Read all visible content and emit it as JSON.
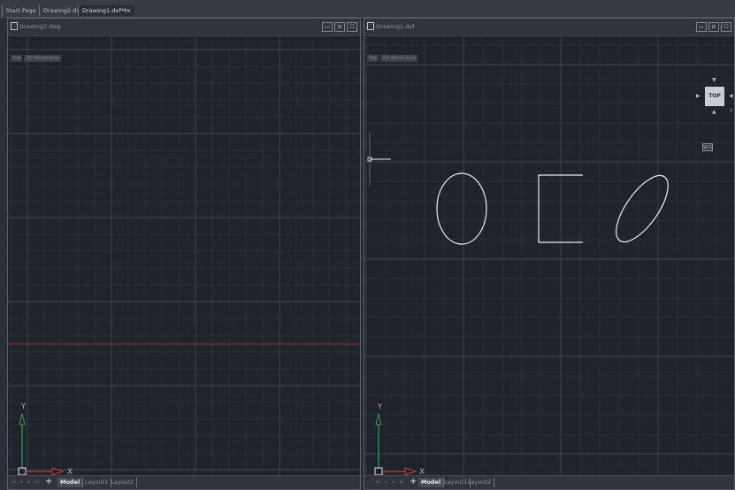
{
  "tabs": [
    {
      "label": "Start Page"
    },
    {
      "label": "Drawing2.dwg"
    },
    {
      "label": "Drawing1.dxf*",
      "close": "×"
    }
  ],
  "new_tab_symbol": "+",
  "left_viewport": {
    "title": "Drawing2.dwg",
    "controls": [
      "Top",
      "2D Wireframe"
    ],
    "window_buttons": [
      "▭",
      "⊟",
      "☐"
    ],
    "ucs": {
      "x_label": "X",
      "y_label": "Y"
    },
    "layout_tabs": [
      "Model",
      "Layout1",
      "Layout2"
    ],
    "active_layout": "Model"
  },
  "right_viewport": {
    "title": "Drawing1.dxf",
    "controls": [
      "Top",
      "2D Wireframe"
    ],
    "window_buttons": [
      "▭",
      "⊟",
      "☐"
    ],
    "viewcube_face": "TOP",
    "wcs_label": "WCS",
    "ucs": {
      "x_label": "X",
      "y_label": "Y"
    },
    "layout_tabs": [
      "Model",
      "Layout1",
      "Layout2"
    ],
    "active_layout": "Model"
  },
  "layout_nav_symbols": [
    "|◂",
    "◂",
    "▸",
    "▸|"
  ],
  "layout_add_symbol": "+",
  "colors": {
    "background": "#1f242c",
    "grid_minor": "#2c333d",
    "grid_major": "#3c4450",
    "x_axis": "#c9353b",
    "y_axis": "#3aa049",
    "shapes": "#e8ecf2"
  }
}
